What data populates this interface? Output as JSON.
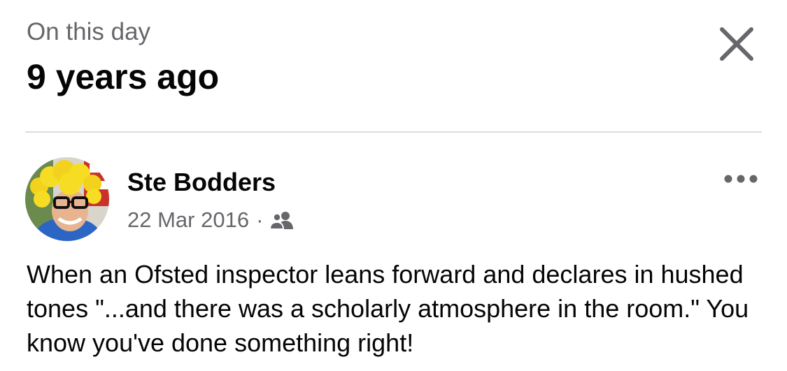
{
  "header": {
    "subtitle": "On this day",
    "title": "9 years ago",
    "close_icon": "close-icon"
  },
  "post": {
    "author": "Ste Bodders",
    "date": "22 Mar 2016",
    "separator": "·",
    "audience_icon": "friends-icon",
    "more_icon": "more-options-icon",
    "text": "When an Ofsted inspector leans forward and declares in hushed tones \"...and there was a scholarly atmosphere in the room.\" You know you've done something right!"
  },
  "colors": {
    "primary_text": "#050505",
    "secondary_text": "#65676b",
    "divider": "#dcdde0"
  }
}
